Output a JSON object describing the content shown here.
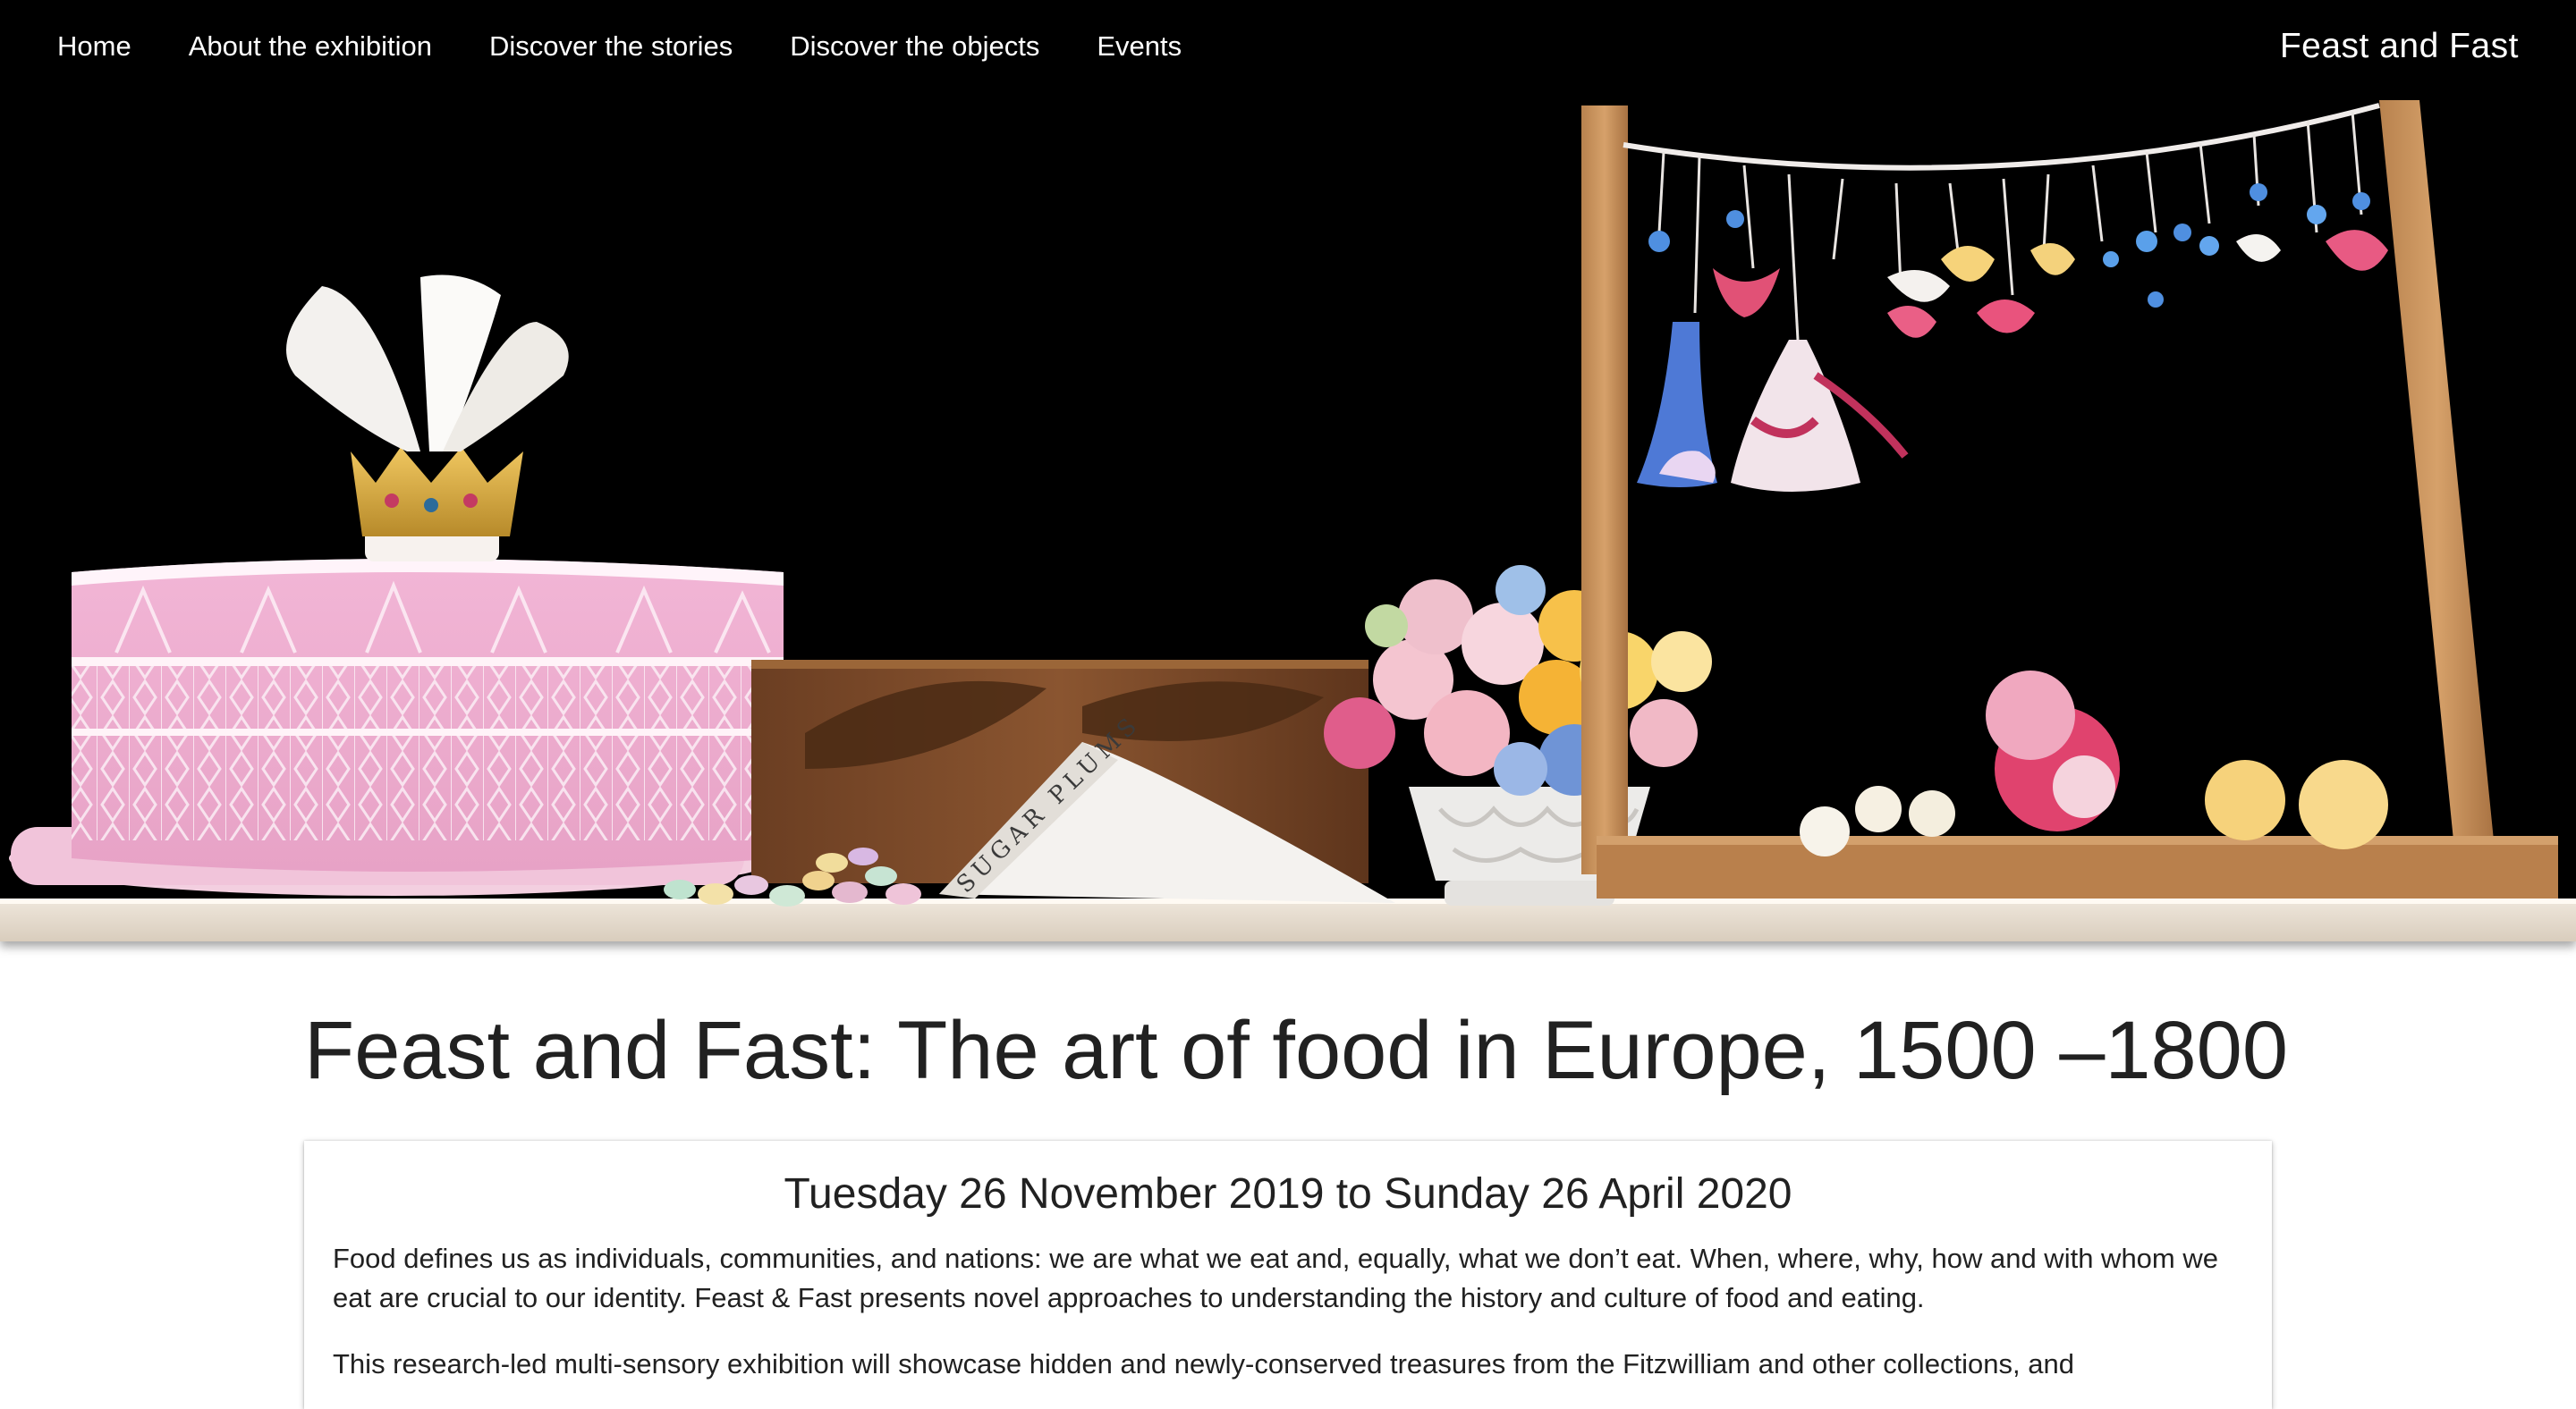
{
  "nav": {
    "links": [
      {
        "label": "Home"
      },
      {
        "label": "About the exhibition"
      },
      {
        "label": "Discover the stories"
      },
      {
        "label": "Discover the objects"
      },
      {
        "label": "Events"
      }
    ],
    "brand": "Feast and Fast"
  },
  "hero": {
    "cone_text": "SUGAR PLUMS",
    "background": "#000000"
  },
  "main": {
    "title": "Feast and Fast: The art of food in Europe, 1500 –1800",
    "card": {
      "dates": "Tuesday 26 November 2019 to Sunday 26 April 2020",
      "paragraph_1": "Food defines us as individuals, communities, and nations: we are what we eat and, equally, what we don’t eat. When, where, why, how and with whom we eat are crucial to our identity. Feast & Fast presents novel approaches to understanding the history and culture of food and eating.",
      "paragraph_2": "This research-led multi-sensory exhibition will showcase hidden and newly-conserved treasures from the Fitzwilliam and other collections, and"
    }
  }
}
